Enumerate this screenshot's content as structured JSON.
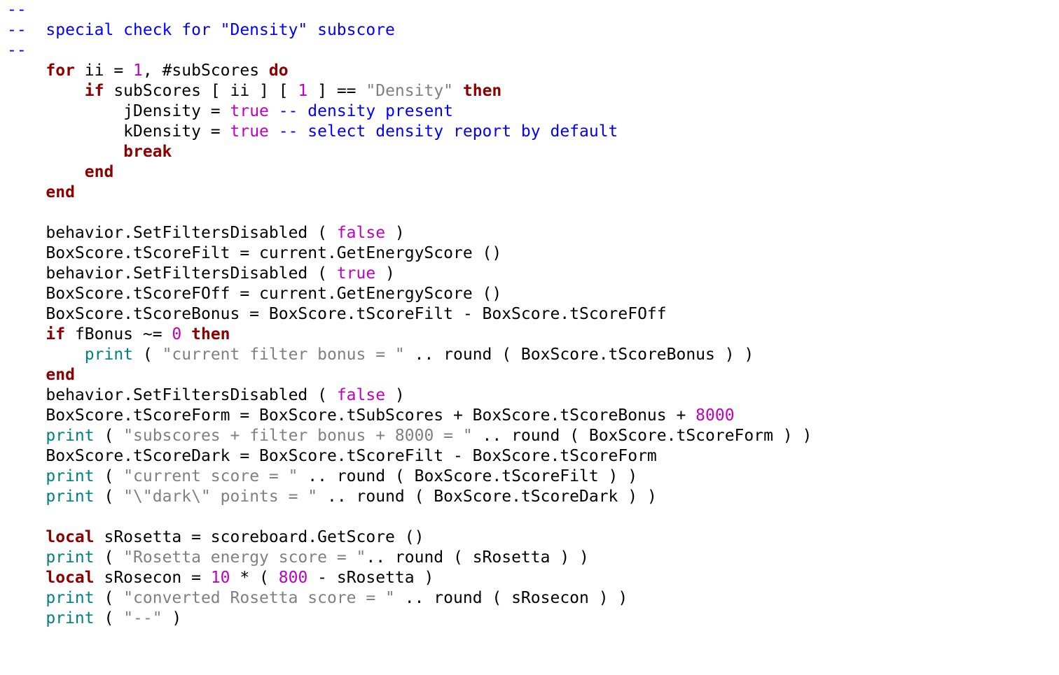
{
  "colors": {
    "comment": "#0000ff",
    "keyword": "#8b0000",
    "func": "#008080",
    "number": "#c000c0",
    "string": "#808080",
    "default": "#000000",
    "background": "#ffffff"
  },
  "tokens": [
    [
      [
        "comment",
        "--"
      ]
    ],
    [
      [
        "comment",
        "--  special check for \"Density\" subscore"
      ]
    ],
    [
      [
        "comment",
        "--"
      ]
    ],
    [
      [
        "text",
        "    "
      ],
      [
        "keyword",
        "for"
      ],
      [
        "text",
        " ii = "
      ],
      [
        "number",
        "1"
      ],
      [
        "text",
        ", #subScores "
      ],
      [
        "keyword",
        "do"
      ],
      [
        "text",
        ""
      ]
    ],
    [
      [
        "text",
        "        "
      ],
      [
        "keyword",
        "if"
      ],
      [
        "text",
        " subScores [ ii ] [ "
      ],
      [
        "number",
        "1"
      ],
      [
        "text",
        " ] == "
      ],
      [
        "string",
        "\"Density\""
      ],
      [
        "text",
        " "
      ],
      [
        "keyword",
        "then"
      ]
    ],
    [
      [
        "text",
        "            jDensity = "
      ],
      [
        "number",
        "true"
      ],
      [
        "text",
        " "
      ],
      [
        "comment",
        "-- density present"
      ]
    ],
    [
      [
        "text",
        "            kDensity = "
      ],
      [
        "number",
        "true"
      ],
      [
        "text",
        " "
      ],
      [
        "comment",
        "-- select density report by default"
      ]
    ],
    [
      [
        "text",
        "            "
      ],
      [
        "keyword",
        "break"
      ]
    ],
    [
      [
        "text",
        "        "
      ],
      [
        "keyword",
        "end"
      ]
    ],
    [
      [
        "text",
        "    "
      ],
      [
        "keyword",
        "end"
      ]
    ],
    [
      [
        "blank",
        ""
      ]
    ],
    [
      [
        "text",
        "    behavior.SetFiltersDisabled ( "
      ],
      [
        "number",
        "false"
      ],
      [
        "text",
        " )"
      ]
    ],
    [
      [
        "text",
        "    BoxScore.tScoreFilt = current.GetEnergyScore ()"
      ]
    ],
    [
      [
        "text",
        "    behavior.SetFiltersDisabled ( "
      ],
      [
        "number",
        "true"
      ],
      [
        "text",
        " )"
      ]
    ],
    [
      [
        "text",
        "    BoxScore.tScoreFOff = current.GetEnergyScore ()"
      ]
    ],
    [
      [
        "text",
        "    BoxScore.tScoreBonus = BoxScore.tScoreFilt - BoxScore.tScoreFOff"
      ]
    ],
    [
      [
        "text",
        "    "
      ],
      [
        "keyword",
        "if"
      ],
      [
        "text",
        " fBonus ~= "
      ],
      [
        "number",
        "0"
      ],
      [
        "text",
        " "
      ],
      [
        "keyword",
        "then"
      ]
    ],
    [
      [
        "text",
        "        "
      ],
      [
        "func",
        "print"
      ],
      [
        "text",
        " ( "
      ],
      [
        "string",
        "\"current filter bonus = \""
      ],
      [
        "text",
        " .. round ( BoxScore.tScoreBonus ) )"
      ]
    ],
    [
      [
        "text",
        "    "
      ],
      [
        "keyword",
        "end"
      ]
    ],
    [
      [
        "text",
        "    behavior.SetFiltersDisabled ( "
      ],
      [
        "number",
        "false"
      ],
      [
        "text",
        " )"
      ]
    ],
    [
      [
        "text",
        "    BoxScore.tScoreForm = BoxScore.tSubScores + BoxScore.tScoreBonus + "
      ],
      [
        "number",
        "8000"
      ]
    ],
    [
      [
        "text",
        "    "
      ],
      [
        "func",
        "print"
      ],
      [
        "text",
        " ( "
      ],
      [
        "string",
        "\"subscores + filter bonus + 8000 = \""
      ],
      [
        "text",
        " .. round ( BoxScore.tScoreForm ) )"
      ]
    ],
    [
      [
        "text",
        "    BoxScore.tScoreDark = BoxScore.tScoreFilt - BoxScore.tScoreForm"
      ]
    ],
    [
      [
        "text",
        "    "
      ],
      [
        "func",
        "print"
      ],
      [
        "text",
        " ( "
      ],
      [
        "string",
        "\"current score = \""
      ],
      [
        "text",
        " .. round ( BoxScore.tScoreFilt ) )"
      ]
    ],
    [
      [
        "text",
        "    "
      ],
      [
        "func",
        "print"
      ],
      [
        "text",
        " ( "
      ],
      [
        "string",
        "\"\\\"dark\\\" points = \""
      ],
      [
        "text",
        " .. round ( BoxScore.tScoreDark ) )"
      ]
    ],
    [
      [
        "blank",
        ""
      ]
    ],
    [
      [
        "text",
        "    "
      ],
      [
        "keyword",
        "local"
      ],
      [
        "text",
        " sRosetta = scoreboard.GetScore ()"
      ]
    ],
    [
      [
        "text",
        "    "
      ],
      [
        "func",
        "print"
      ],
      [
        "text",
        " ( "
      ],
      [
        "string",
        "\"Rosetta energy score = \""
      ],
      [
        "text",
        ".. round ( sRosetta ) )"
      ]
    ],
    [
      [
        "text",
        "    "
      ],
      [
        "keyword",
        "local"
      ],
      [
        "text",
        " sRosecon = "
      ],
      [
        "number",
        "10"
      ],
      [
        "text",
        " * ( "
      ],
      [
        "number",
        "800"
      ],
      [
        "text",
        " - sRosetta )"
      ]
    ],
    [
      [
        "text",
        "    "
      ],
      [
        "func",
        "print"
      ],
      [
        "text",
        " ( "
      ],
      [
        "string",
        "\"converted Rosetta score = \""
      ],
      [
        "text",
        " .. round ( sRosecon ) )"
      ]
    ],
    [
      [
        "text",
        "    "
      ],
      [
        "func",
        "print"
      ],
      [
        "text",
        " ( "
      ],
      [
        "string",
        "\"--\""
      ],
      [
        "text",
        " )"
      ]
    ]
  ]
}
